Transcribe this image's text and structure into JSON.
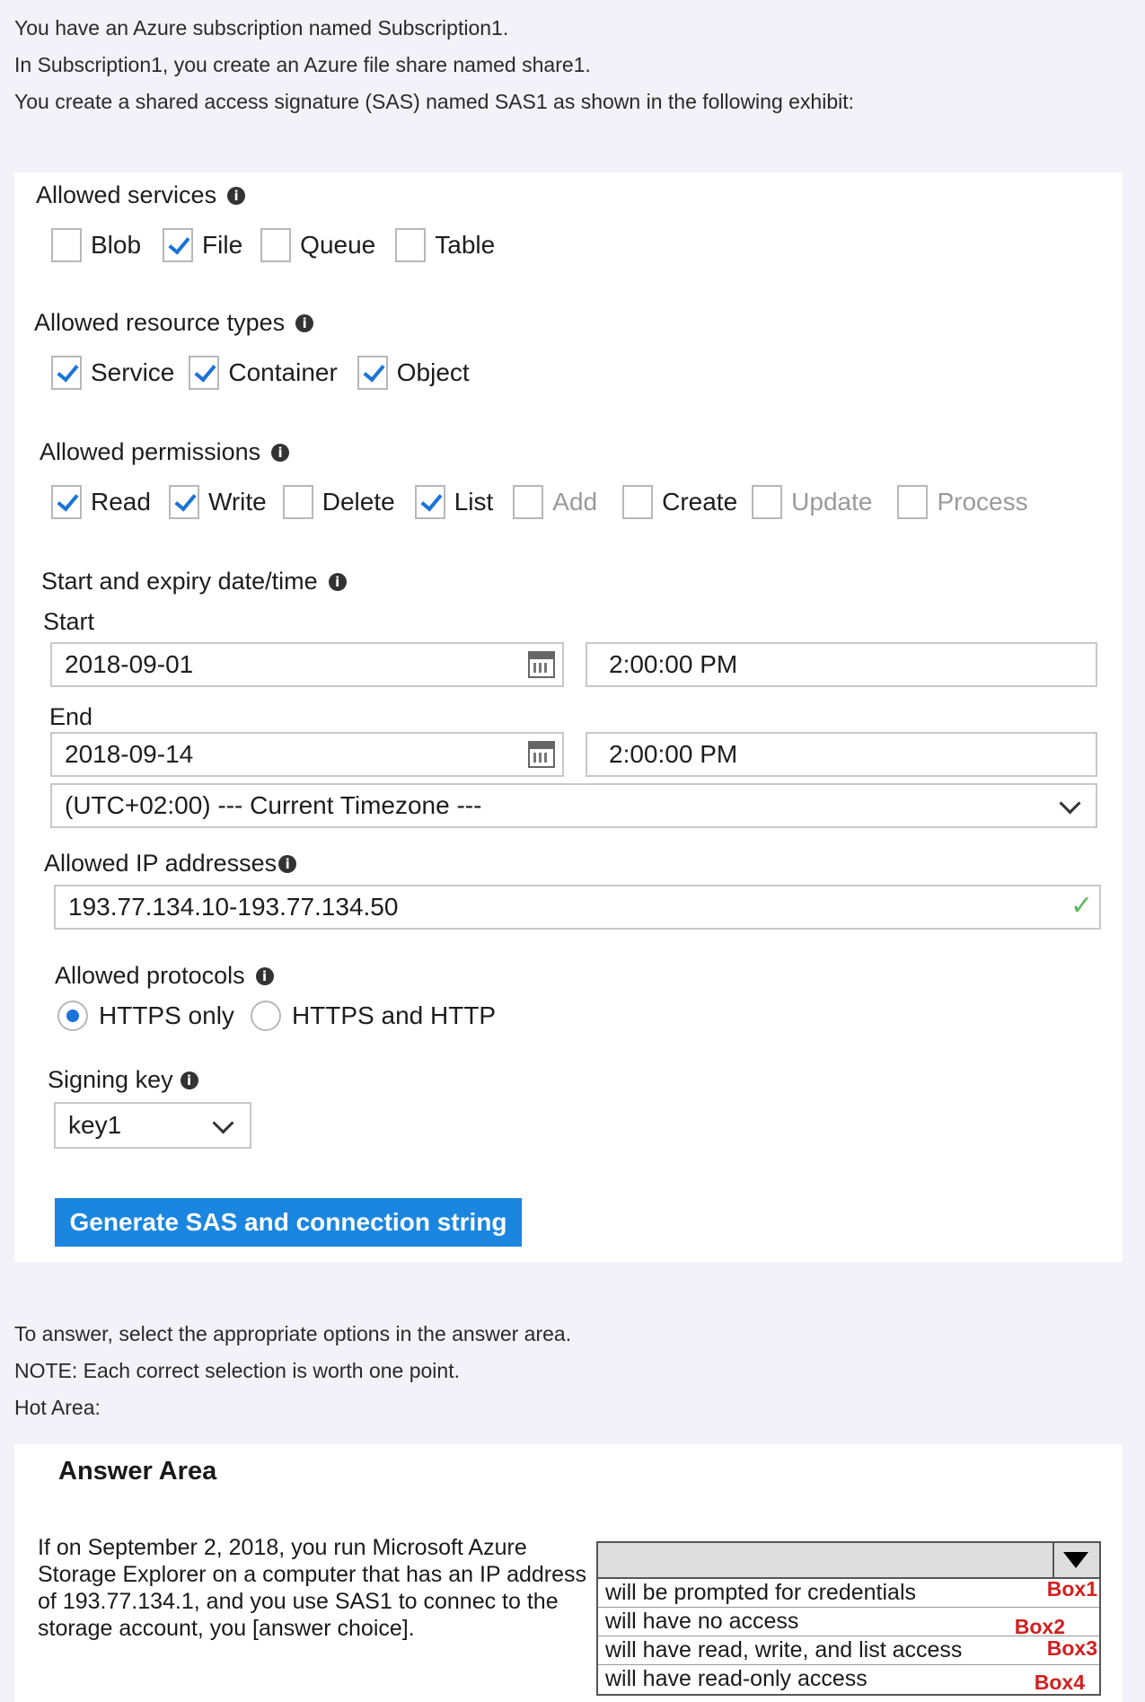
{
  "intro": [
    "You have an Azure subscription named Subscription1.",
    "In Subscription1, you create an Azure file share named share1.",
    "You create a shared access signature (SAS) named SAS1 as shown in the following exhibit:"
  ],
  "allowed_services": {
    "label": "Allowed services",
    "items": [
      {
        "label": "Blob",
        "checked": false
      },
      {
        "label": "File",
        "checked": true
      },
      {
        "label": "Queue",
        "checked": false
      },
      {
        "label": "Table",
        "checked": false
      }
    ]
  },
  "allowed_resource_types": {
    "label": "Allowed resource types",
    "items": [
      {
        "label": "Service",
        "checked": true
      },
      {
        "label": "Container",
        "checked": true
      },
      {
        "label": "Object",
        "checked": true
      }
    ]
  },
  "allowed_permissions": {
    "label": "Allowed permissions",
    "items": [
      {
        "label": "Read",
        "checked": true
      },
      {
        "label": "Write",
        "checked": true
      },
      {
        "label": "Delete",
        "checked": false
      },
      {
        "label": "List",
        "checked": true
      },
      {
        "label": "Add",
        "checked": false
      },
      {
        "label": "Create",
        "checked": false
      },
      {
        "label": "Update",
        "checked": false
      },
      {
        "label": "Process",
        "checked": false
      }
    ]
  },
  "dates": {
    "label": "Start and expiry date/time",
    "start_label": "Start",
    "start_date": "2018-09-01",
    "start_time": "2:00:00 PM",
    "end_label": "End",
    "end_date": "2018-09-14",
    "end_time": "2:00:00 PM",
    "timezone": "(UTC+02:00) --- Current Timezone ---"
  },
  "ip": {
    "label": "Allowed IP addresses",
    "value": "193.77.134.10-193.77.134.50"
  },
  "protocols": {
    "label": "Allowed protocols",
    "options": [
      "HTTPS only",
      "HTTPS and HTTP"
    ],
    "selected": "HTTPS only"
  },
  "signing_key": {
    "label": "Signing key",
    "value": "key1"
  },
  "generate_button": "Generate SAS and connection string",
  "instructions": [
    "To answer, select the appropriate options in the answer area.",
    "NOTE: Each correct selection is worth one point.",
    "Hot Area:"
  ],
  "answer_area": {
    "title": "Answer Area",
    "question": "If on September 2, 2018, you run Microsoft Azure Storage Explorer on a computer that has an IP address of 193.77.134.1, and you use SAS1 to connec to the storage account, you [answer choice].",
    "options": [
      {
        "text": "will be prompted for credentials",
        "tag": "Box1"
      },
      {
        "text": "will have no access",
        "tag": "Box2"
      },
      {
        "text": "will have read, write, and list access",
        "tag": "Box3"
      },
      {
        "text": "will have read-only access",
        "tag": "Box4"
      }
    ]
  },
  "colors": {
    "accent": "#1a73d9",
    "button": "#1a86e0",
    "valid_check": "#5cb85c",
    "box_tag": "#d12020"
  }
}
